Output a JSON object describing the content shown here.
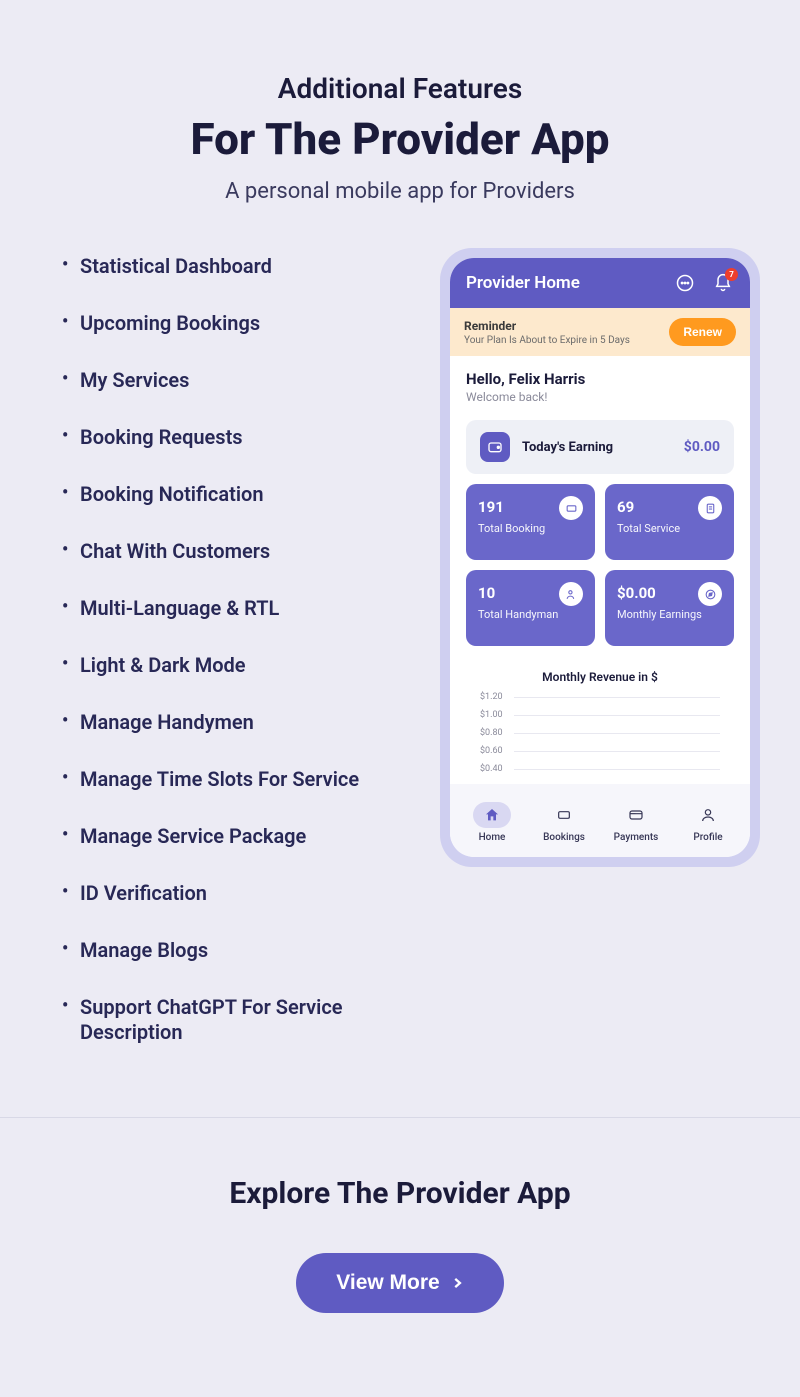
{
  "header": {
    "overline": "Additional Features",
    "title": "For The Provider App",
    "subtitle": "A personal mobile app for Providers"
  },
  "features": [
    "Statistical Dashboard",
    "Upcoming Bookings",
    "My Services",
    "Booking Requests",
    "Booking Notification",
    "Chat With Customers",
    "Multi-Language & RTL",
    "Light & Dark Mode",
    "Manage Handymen",
    "Manage Time Slots For Service",
    "Manage Service Package",
    "ID Verification",
    "Manage Blogs",
    "Support ChatGPT For Service Description"
  ],
  "phone": {
    "header_title": "Provider Home",
    "notif_badge": "7",
    "reminder": {
      "title": "Reminder",
      "text": "Your Plan Is About to Expire in 5 Days",
      "button": "Renew"
    },
    "greeting": {
      "hello": "Hello, Felix Harris",
      "welcome": "Welcome back!"
    },
    "earning": {
      "label": "Today's Earning",
      "value": "$0.00"
    },
    "stats": [
      {
        "value": "191",
        "label": "Total Booking"
      },
      {
        "value": "69",
        "label": "Total Service"
      },
      {
        "value": "10",
        "label": "Total Handyman"
      },
      {
        "value": "$0.00",
        "label": "Monthly Earnings"
      }
    ],
    "chart": {
      "title": "Monthly Revenue in $",
      "yticks": [
        "$1.20",
        "$1.00",
        "$0.80",
        "$0.60",
        "$0.40"
      ]
    },
    "nav": [
      {
        "label": "Home",
        "active": true
      },
      {
        "label": "Bookings",
        "active": false
      },
      {
        "label": "Payments",
        "active": false
      },
      {
        "label": "Profile",
        "active": false
      }
    ]
  },
  "footer": {
    "title": "Explore The Provider App",
    "button": "View More"
  },
  "chart_data": {
    "type": "line",
    "title": "Monthly Revenue in $",
    "xlabel": "",
    "ylabel": "",
    "ylim": [
      0.4,
      1.2
    ],
    "yticks": [
      0.4,
      0.6,
      0.8,
      1.0,
      1.2
    ],
    "categories": [],
    "values": []
  }
}
